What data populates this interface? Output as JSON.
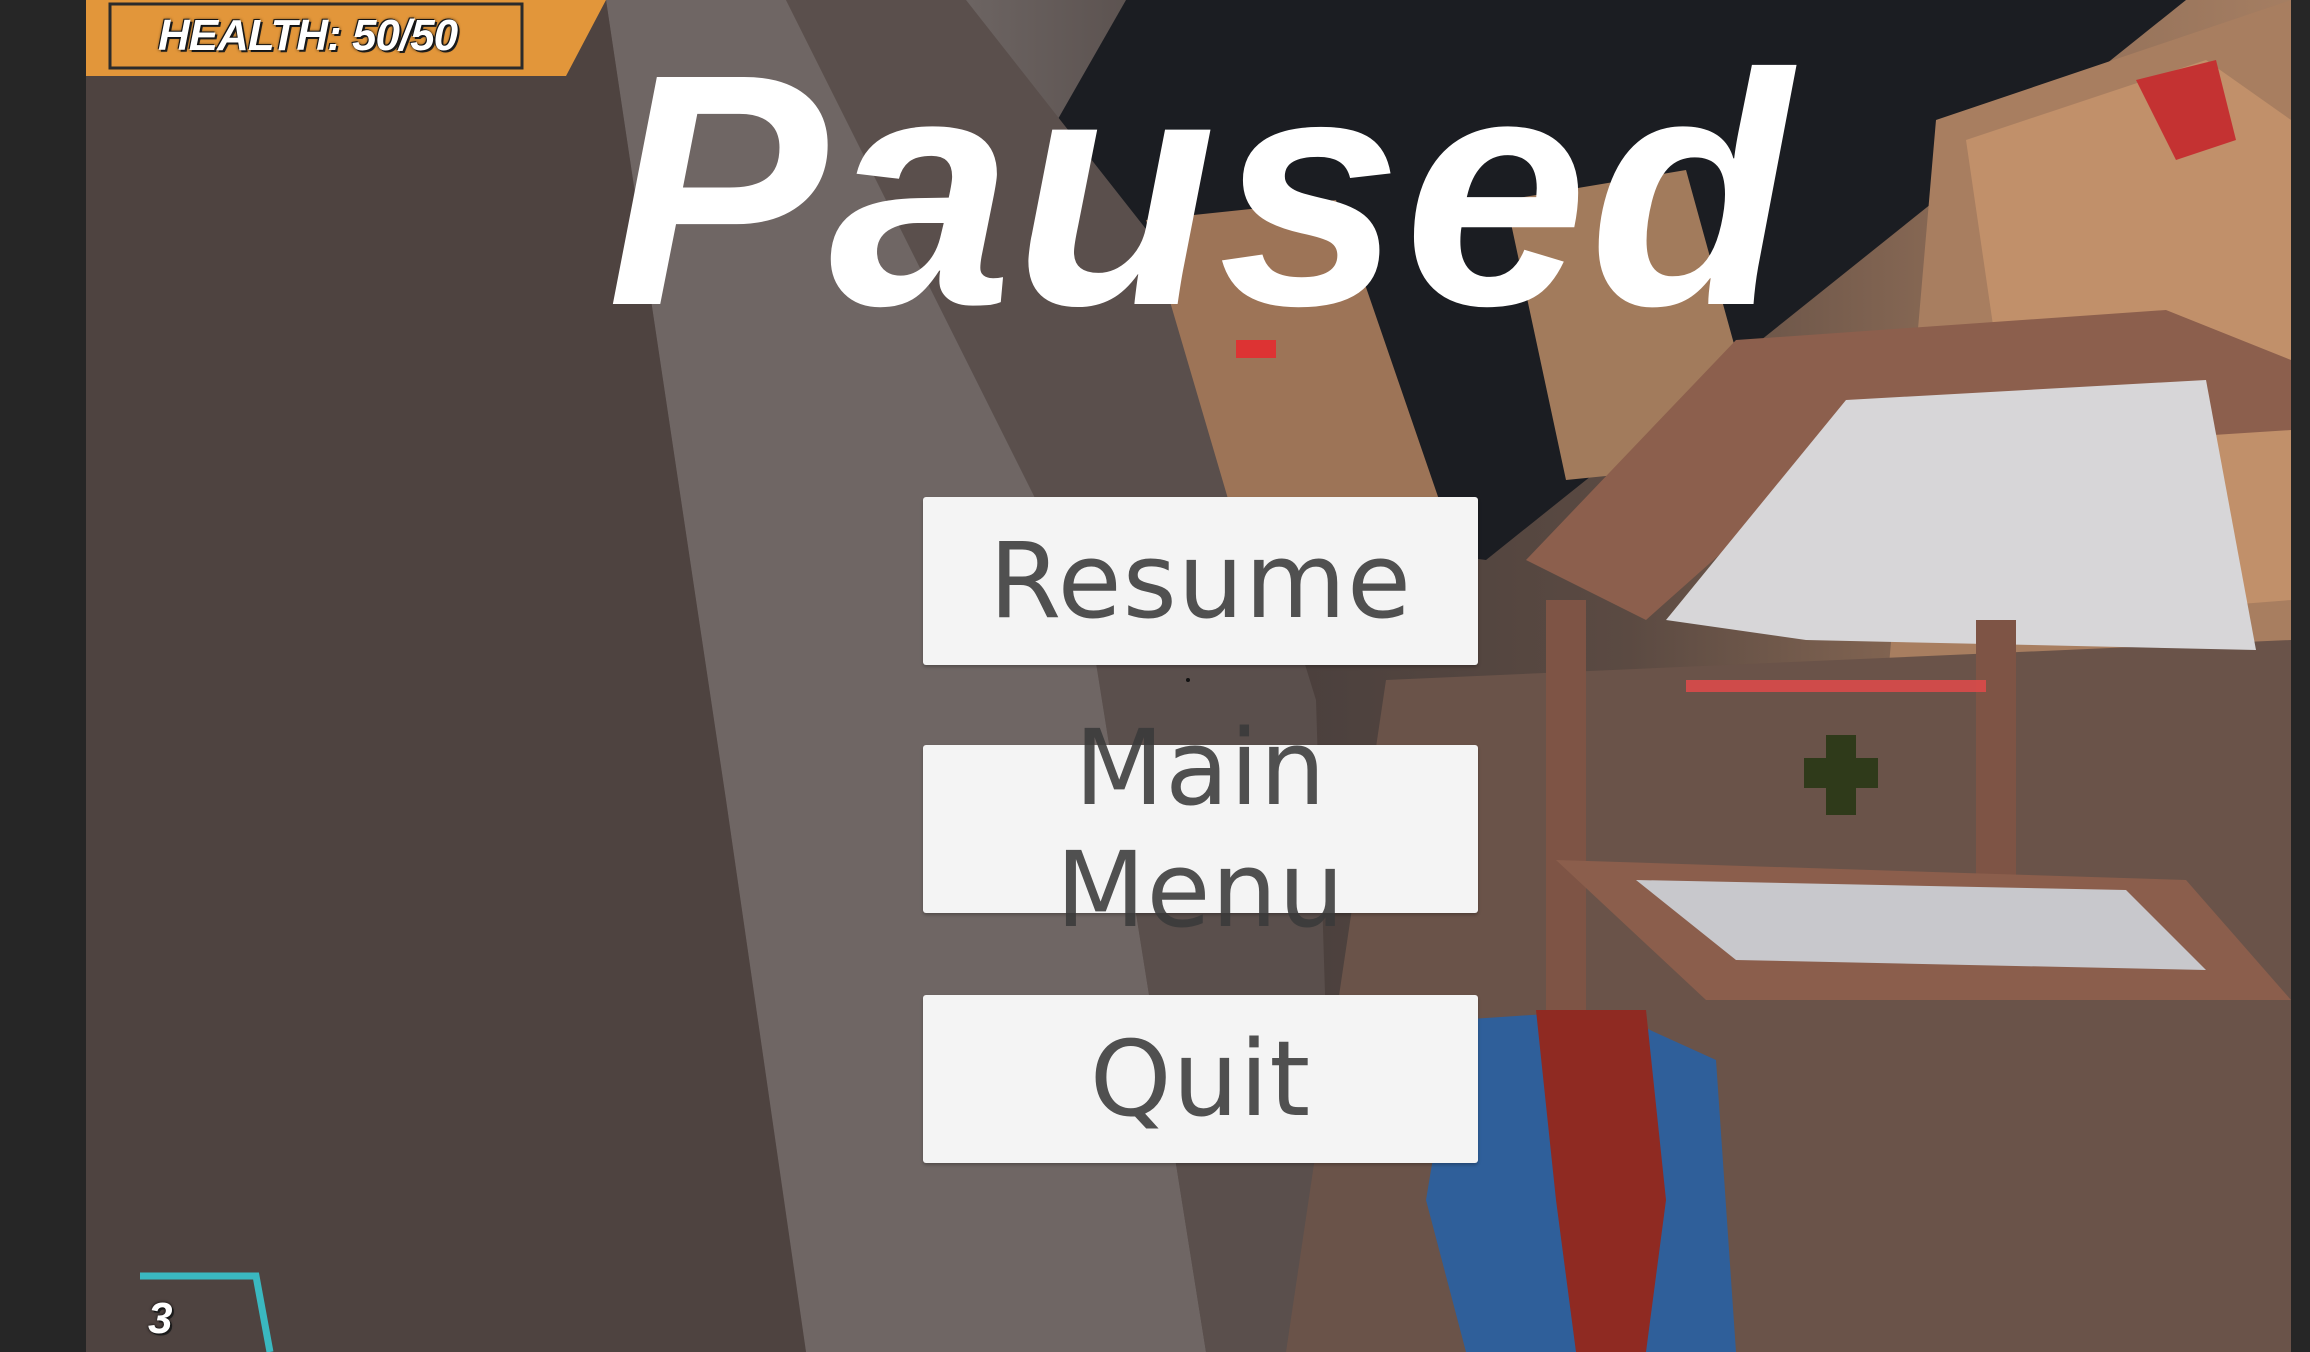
{
  "hud": {
    "health_text": "HEALTH: 50/50",
    "ammo_count": "3",
    "health_color": "#e2963a",
    "ammo_frame_color": "#3ab8c0"
  },
  "pause_menu": {
    "title": "Paused",
    "buttons": {
      "resume": "Resume",
      "main_menu": "Main Menu",
      "quit": "Quit"
    }
  }
}
